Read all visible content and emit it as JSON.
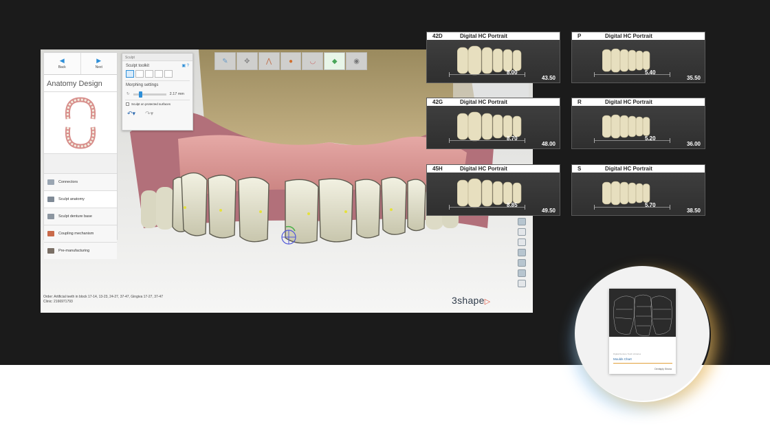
{
  "app": {
    "nav": {
      "back_label": "Back",
      "next_label": "Next"
    },
    "panel_title": "Anatomy Design",
    "steps": [
      {
        "label": "Connectors",
        "color": "#9aa6b2"
      },
      {
        "label": "Sculpt anatomy",
        "color": "#7f8a96"
      },
      {
        "label": "Sculpt denture base",
        "color": "#8c96a0"
      },
      {
        "label": "Coupling mechanism",
        "color": "#c96a4a"
      },
      {
        "label": "Pre-manufacturing",
        "color": "#7a6f66"
      }
    ],
    "sculpt": {
      "window_title": "Sculpt",
      "toolkit_label": "Sculpt toolkit",
      "morphing_label": "Morphing settings",
      "size_value": "2.17 mm",
      "checkbox_label": "Sculpt on protected surfaces"
    },
    "order_line": "Order:  Artificial teeth in block 17-14, 13-23, 24-27, 37-47, Gingiva 17-27, 37-47",
    "clinic_line": "Clinic:  2166971793",
    "logo_text": "3shape"
  },
  "cards": [
    {
      "code": "42D",
      "name": "Digital HC Portrait",
      "width": "8.00",
      "length": "43.50"
    },
    {
      "code": "P",
      "name": "Digital HC Portrait",
      "width": "5.40",
      "length": "35.50"
    },
    {
      "code": "42G",
      "name": "Digital HC Portrait",
      "width": "8.70",
      "length": "48.00"
    },
    {
      "code": "R",
      "name": "Digital HC Portrait",
      "width": "5.20",
      "length": "36.00"
    },
    {
      "code": "45H",
      "name": "Digital HC Portrait",
      "width": "8.85",
      "length": "49.50"
    },
    {
      "code": "S",
      "name": "Digital HC Portrait",
      "width": "5.70",
      "length": "38.50"
    }
  ],
  "brochure": {
    "subtitle": "Digital Denture Tooth Libraries",
    "title": "Moulds Chart",
    "brand": "Dentsply Sirona"
  }
}
